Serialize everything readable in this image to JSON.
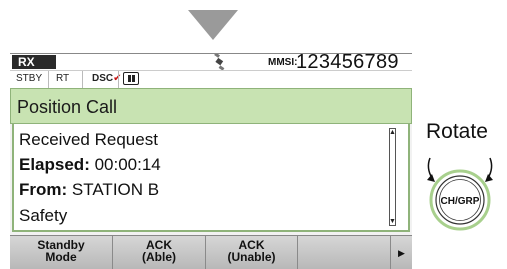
{
  "status": {
    "rx_label": "RX",
    "mmsi_label": "MMSI:",
    "mmsi_value": "123456789"
  },
  "modes": {
    "stby": "STBY",
    "rt": "RT",
    "dsc": "DSC",
    "dsc_check": "✔"
  },
  "screen": {
    "title": "Position Call",
    "request": "Received Request",
    "elapsed_key": "Elapsed:",
    "elapsed_value": " 00:00:14",
    "from_key": "From:",
    "from_value": " STATION B",
    "category": "Safety"
  },
  "softkeys": {
    "standby_line1": "Standby",
    "standby_line2": "Mode",
    "ack_able_line1": "ACK",
    "ack_able_line2": "(Able)",
    "ack_unable_line1": "ACK",
    "ack_unable_line2": "(Unable)",
    "next_symbol": "▶"
  },
  "knob": {
    "rotate_label": "Rotate",
    "knob_label": "CH/GRP"
  },
  "icons": {
    "arrow": "arrow-down-icon",
    "gps": "gps-satellite-icon",
    "pause": "pause-icon"
  },
  "colors": {
    "title_bar": "#c8e3b2",
    "title_border": "#8fb37a",
    "dsc_check": "#c81414",
    "knob_ring": "#a8d08d"
  }
}
